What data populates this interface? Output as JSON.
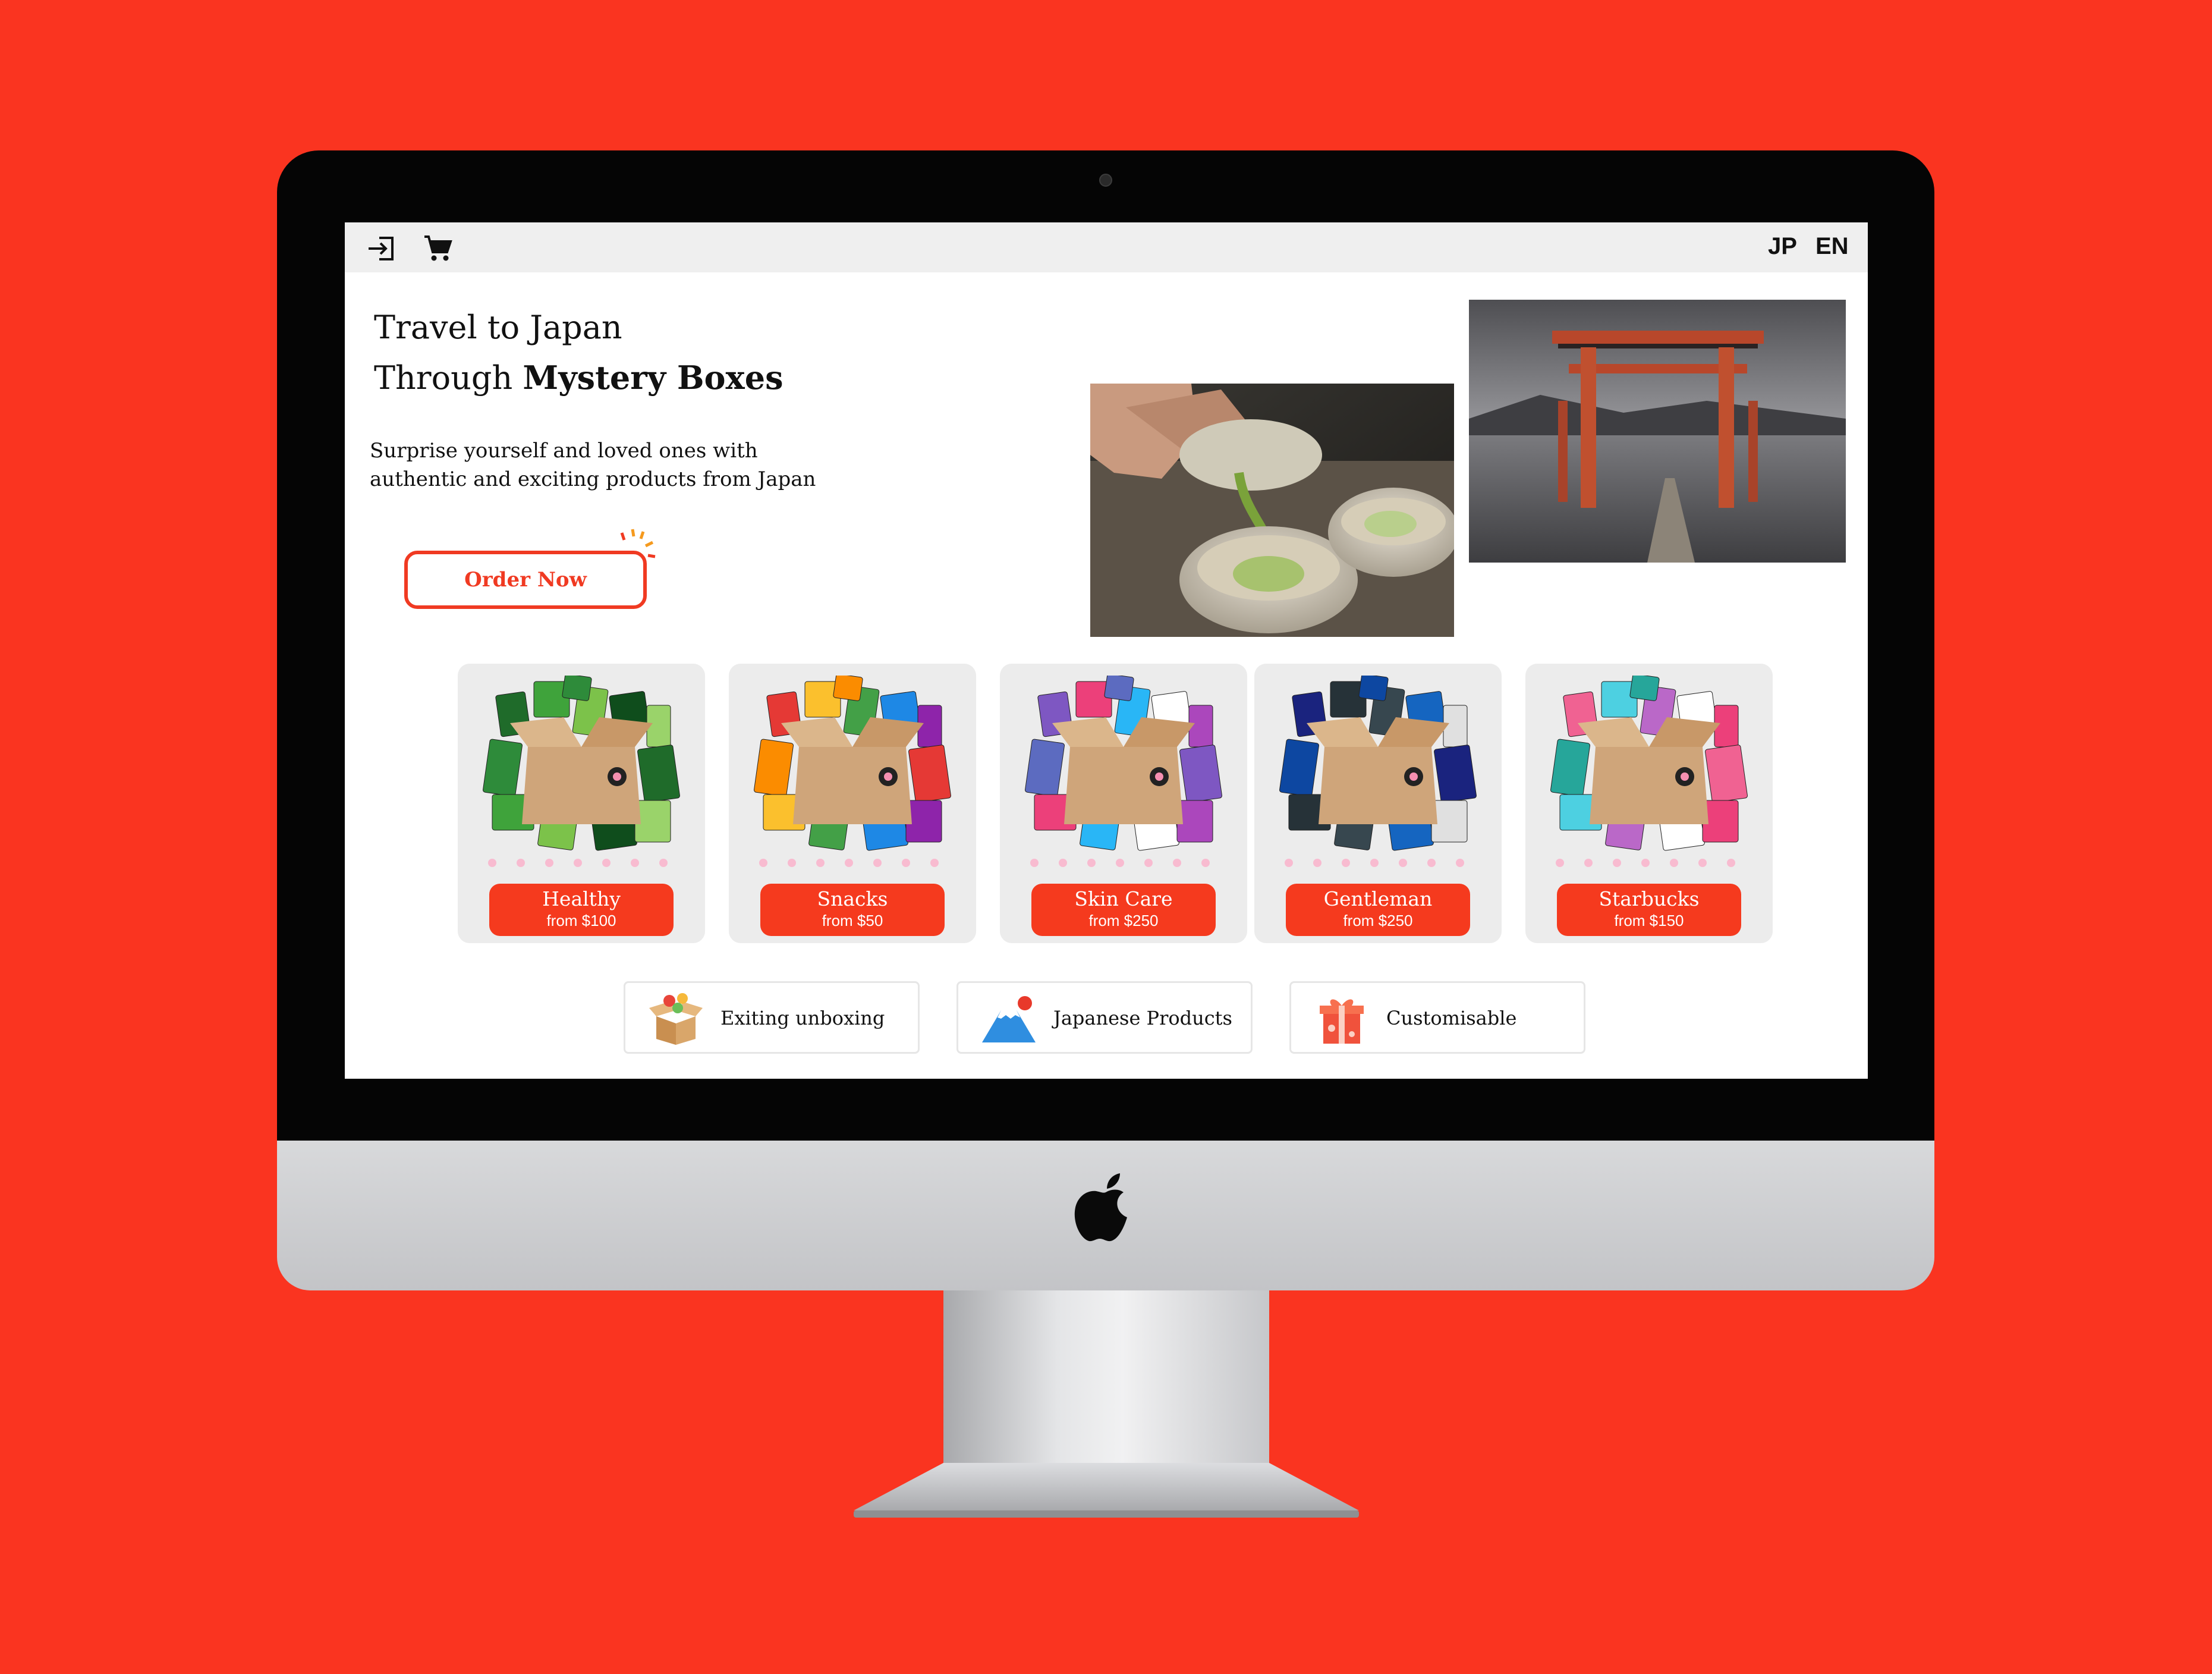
{
  "colors": {
    "background": "#fa3420",
    "accent": "#f53a1e",
    "topbar": "#efefef",
    "card": "#ececec"
  },
  "topbar": {
    "icons": [
      "login-icon",
      "cart-icon"
    ],
    "lang_jp": "JP",
    "lang_en": "EN"
  },
  "hero": {
    "title_line1": "Travel to Japan",
    "title_line2_prefix": "Through ",
    "title_line2_bold": "Mystery Boxes",
    "subtitle": "Surprise yourself and loved ones with authentic and exciting products from Japan",
    "cta_label": "Order Now"
  },
  "photos": [
    "matcha-tea-photo",
    "torii-gate-photo"
  ],
  "boxes": [
    {
      "name": "Healthy",
      "price": "from $100",
      "theme": "green"
    },
    {
      "name": "Snacks",
      "price": "from $50",
      "theme": "mixed"
    },
    {
      "name": "Skin Care",
      "price": "from $250",
      "theme": "pastel"
    },
    {
      "name": "Gentleman",
      "price": "from $250",
      "theme": "navy"
    },
    {
      "name": "Starbucks",
      "price": "from $150",
      "theme": "pink"
    }
  ],
  "features": [
    {
      "label": "Exiting unboxing",
      "icon": "open-box-icon"
    },
    {
      "label": "Japanese Products",
      "icon": "mount-fuji-icon"
    },
    {
      "label": "Customisable",
      "icon": "gift-icon"
    }
  ],
  "device": {
    "logo": "apple-logo-icon"
  }
}
